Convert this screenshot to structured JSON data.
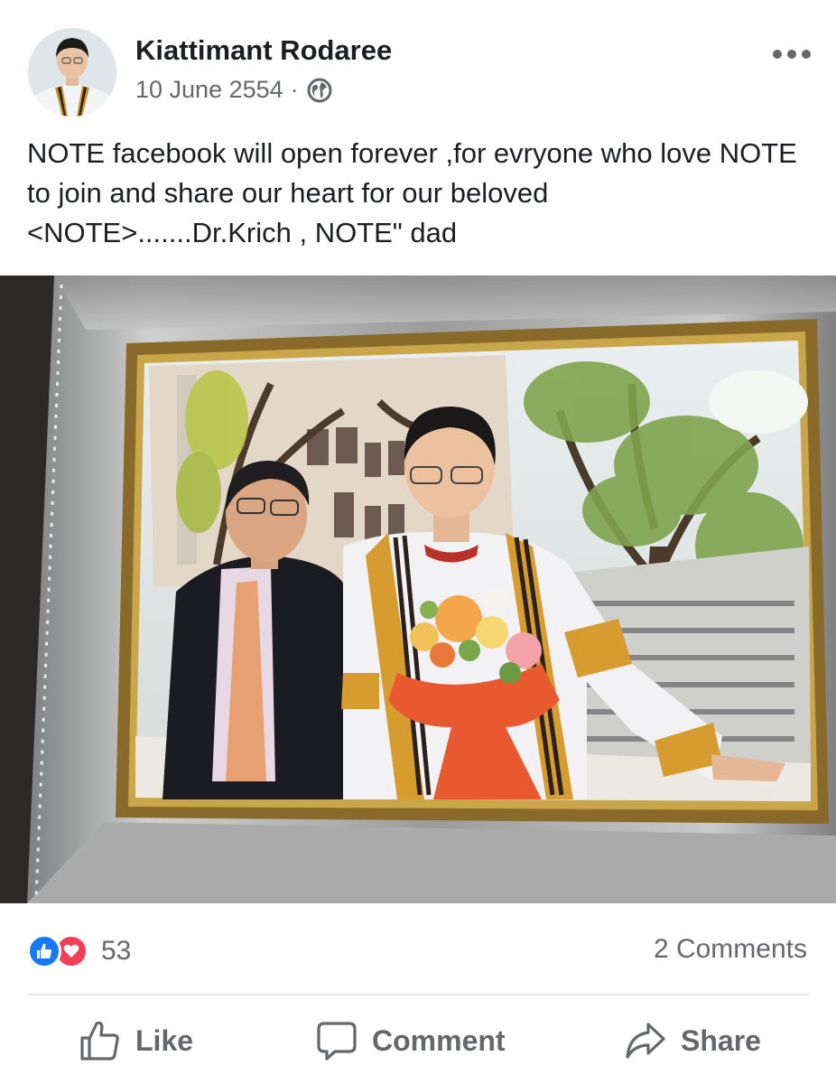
{
  "post": {
    "author": "Kiattimant Rodaree",
    "date": "10 June 2554",
    "separator": "·",
    "privacy_icon": "globe-icon",
    "more_icon": "more-options-icon",
    "text": "NOTE  facebook will open forever ,for evryone who love NOTE to join and share our heart for our beloved <NOTE>.......Dr.Krich , NOTE\" dad"
  },
  "reactions": {
    "count": "53",
    "types": [
      "like",
      "love"
    ],
    "like_color": "#1877f2",
    "love_color": "#f33e58"
  },
  "comments": {
    "label": "2 Comments"
  },
  "actions": {
    "like": {
      "label": "Like",
      "icon": "thumbs-up-icon"
    },
    "comment": {
      "label": "Comment",
      "icon": "speech-bubble-icon"
    },
    "share": {
      "label": "Share",
      "icon": "share-arrow-icon"
    }
  },
  "colors": {
    "text": "#1c1e21",
    "secondary": "#65676b",
    "divider": "#e4e6eb"
  }
}
